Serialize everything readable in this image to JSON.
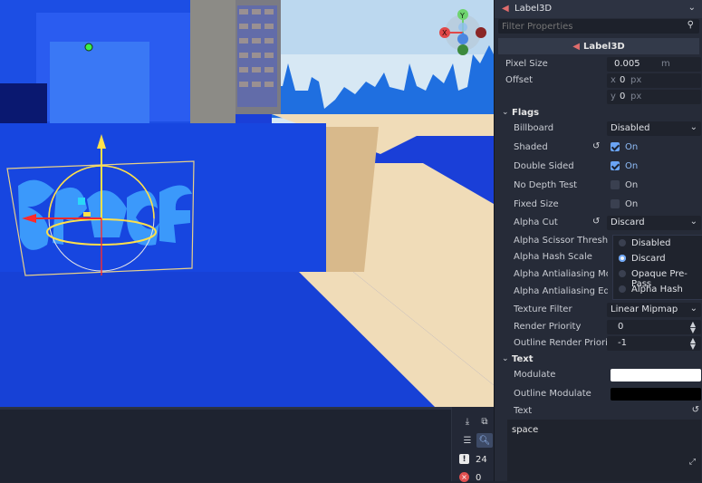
{
  "inspector": {
    "node_name": "Label3D",
    "filter_placeholder": "Filter Properties",
    "class_name": "Label3D",
    "pixel_size": {
      "label": "Pixel Size",
      "value": "0.005",
      "unit": "m"
    },
    "offset": {
      "label": "Offset",
      "x_axis": "x",
      "x": "0",
      "y_axis": "y",
      "y": "0",
      "unit": "px"
    },
    "flags": {
      "title": "Flags",
      "billboard": {
        "label": "Billboard",
        "value": "Disabled"
      },
      "shaded": {
        "label": "Shaded",
        "value": "On",
        "checked": true
      },
      "double_sided": {
        "label": "Double Sided",
        "value": "On",
        "checked": true
      },
      "no_depth_test": {
        "label": "No Depth Test",
        "value": "On",
        "checked": false
      },
      "fixed_size": {
        "label": "Fixed Size",
        "value": "On",
        "checked": false
      },
      "alpha_cut": {
        "label": "Alpha Cut",
        "value": "Discard"
      },
      "alpha_scissor": {
        "label": "Alpha Scissor Thresho"
      },
      "alpha_hash": {
        "label": "Alpha Hash Scale"
      },
      "alpha_aa_mode": {
        "label": "Alpha Antialiasing Mo"
      },
      "alpha_aa_edge": {
        "label": "Alpha Antialiasing Ed"
      },
      "alpha_cut_options": [
        "Disabled",
        "Discard",
        "Opaque Pre-Pass",
        "Alpha Hash"
      ],
      "texture_filter": {
        "label": "Texture Filter",
        "value": "Linear Mipmap"
      },
      "render_priority": {
        "label": "Render Priority",
        "value": "0"
      },
      "outline_render_priority": {
        "label": "Outline Render Priorit",
        "value": "-1"
      }
    },
    "text_section": {
      "title": "Text",
      "modulate": {
        "label": "Modulate",
        "color": "#ffffff"
      },
      "outline_modulate": {
        "label": "Outline Modulate",
        "color": "#000000"
      },
      "text_label": "Text",
      "text_value": "space"
    }
  },
  "bottom_panel": {
    "warnings_count": "24",
    "errors_count": "0"
  },
  "icons": [
    "node-icon",
    "search-icon",
    "reset-icon",
    "chevron-down-icon",
    "expand-icon",
    "warning-icon",
    "error-icon"
  ],
  "colors": {
    "accent": "#6aa4f5",
    "label_node": "#e06c6c",
    "viewport_blue": "#1a3fd8"
  }
}
